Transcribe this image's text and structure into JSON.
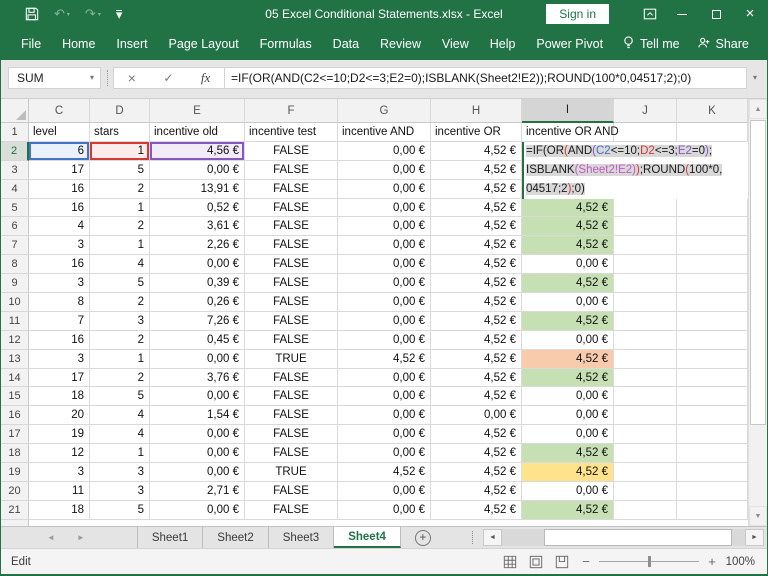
{
  "titlebar": {
    "title": "05 Excel Conditional Statements.xlsx  -  Excel",
    "sign_in_label": "Sign in"
  },
  "menubar": {
    "tabs": [
      "File",
      "Home",
      "Insert",
      "Page Layout",
      "Formulas",
      "Data",
      "Review",
      "View",
      "Help",
      "Power Pivot"
    ],
    "tell_me_label": "Tell me",
    "share_label": "Share"
  },
  "formula_bar": {
    "name_box_value": "SUM",
    "formula": "=IF(OR(AND(C2<=10;D2<=3;E2=0);ISBLANK(Sheet2!E2));ROUND(100*0,04517;2);0)"
  },
  "grid": {
    "column_letters": [
      "C",
      "D",
      "E",
      "F",
      "G",
      "H",
      "I",
      "J",
      "K"
    ],
    "selected_column": "I",
    "active_cell": "I2",
    "header_row": {
      "level": "level",
      "stars": "stars",
      "old": "incentive old",
      "test": "incentive test",
      "and": "incentive AND",
      "or": "incentive OR",
      "oa": "incentive OR AND"
    },
    "rows": [
      {
        "n": "2",
        "level": "6",
        "stars": "1",
        "old": "4,56 €",
        "test": "FALSE",
        "and": "0,00 €",
        "or": "4,52 €",
        "oa": "",
        "fill": "none"
      },
      {
        "n": "3",
        "level": "17",
        "stars": "5",
        "old": "0,00 €",
        "test": "FALSE",
        "and": "0,00 €",
        "or": "4,52 €",
        "oa": "",
        "fill": "none"
      },
      {
        "n": "4",
        "level": "16",
        "stars": "2",
        "old": "13,91 €",
        "test": "FALSE",
        "and": "0,00 €",
        "or": "4,52 €",
        "oa": "",
        "fill": "none"
      },
      {
        "n": "5",
        "level": "16",
        "stars": "1",
        "old": "0,52 €",
        "test": "FALSE",
        "and": "0,00 €",
        "or": "4,52 €",
        "oa": "4,52 €",
        "fill": "green"
      },
      {
        "n": "6",
        "level": "4",
        "stars": "2",
        "old": "3,61 €",
        "test": "FALSE",
        "and": "0,00 €",
        "or": "4,52 €",
        "oa": "4,52 €",
        "fill": "green"
      },
      {
        "n": "7",
        "level": "3",
        "stars": "1",
        "old": "2,26 €",
        "test": "FALSE",
        "and": "0,00 €",
        "or": "4,52 €",
        "oa": "4,52 €",
        "fill": "green"
      },
      {
        "n": "8",
        "level": "16",
        "stars": "4",
        "old": "0,00 €",
        "test": "FALSE",
        "and": "0,00 €",
        "or": "4,52 €",
        "oa": "0,00 €",
        "fill": "none"
      },
      {
        "n": "9",
        "level": "3",
        "stars": "5",
        "old": "0,39 €",
        "test": "FALSE",
        "and": "0,00 €",
        "or": "4,52 €",
        "oa": "4,52 €",
        "fill": "green"
      },
      {
        "n": "10",
        "level": "8",
        "stars": "2",
        "old": "0,26 €",
        "test": "FALSE",
        "and": "0,00 €",
        "or": "4,52 €",
        "oa": "0,00 €",
        "fill": "none"
      },
      {
        "n": "11",
        "level": "7",
        "stars": "3",
        "old": "7,26 €",
        "test": "FALSE",
        "and": "0,00 €",
        "or": "4,52 €",
        "oa": "4,52 €",
        "fill": "green"
      },
      {
        "n": "12",
        "level": "16",
        "stars": "2",
        "old": "0,45 €",
        "test": "FALSE",
        "and": "0,00 €",
        "or": "4,52 €",
        "oa": "0,00 €",
        "fill": "none"
      },
      {
        "n": "13",
        "level": "3",
        "stars": "1",
        "old": "0,00 €",
        "test": "TRUE",
        "and": "4,52 €",
        "or": "4,52 €",
        "oa": "4,52 €",
        "fill": "orange"
      },
      {
        "n": "14",
        "level": "17",
        "stars": "2",
        "old": "3,76 €",
        "test": "FALSE",
        "and": "0,00 €",
        "or": "4,52 €",
        "oa": "4,52 €",
        "fill": "green"
      },
      {
        "n": "15",
        "level": "18",
        "stars": "5",
        "old": "0,00 €",
        "test": "FALSE",
        "and": "0,00 €",
        "or": "4,52 €",
        "oa": "0,00 €",
        "fill": "none"
      },
      {
        "n": "16",
        "level": "20",
        "stars": "4",
        "old": "1,54 €",
        "test": "FALSE",
        "and": "0,00 €",
        "or": "0,00 €",
        "oa": "0,00 €",
        "fill": "none"
      },
      {
        "n": "17",
        "level": "19",
        "stars": "4",
        "old": "0,00 €",
        "test": "FALSE",
        "and": "0,00 €",
        "or": "4,52 €",
        "oa": "0,00 €",
        "fill": "none"
      },
      {
        "n": "18",
        "level": "12",
        "stars": "1",
        "old": "0,00 €",
        "test": "FALSE",
        "and": "0,00 €",
        "or": "4,52 €",
        "oa": "4,52 €",
        "fill": "green"
      },
      {
        "n": "19",
        "level": "3",
        "stars": "3",
        "old": "0,00 €",
        "test": "TRUE",
        "and": "4,52 €",
        "or": "4,52 €",
        "oa": "4,52 €",
        "fill": "yellow"
      },
      {
        "n": "20",
        "level": "11",
        "stars": "3",
        "old": "2,71 €",
        "test": "FALSE",
        "and": "0,00 €",
        "or": "4,52 €",
        "oa": "0,00 €",
        "fill": "none"
      },
      {
        "n": "21",
        "level": "18",
        "stars": "5",
        "old": "0,00 €",
        "test": "FALSE",
        "and": "0,00 €",
        "or": "4,52 €",
        "oa": "4,52 €",
        "fill": "green"
      }
    ],
    "cell_edit": {
      "cell": "I2",
      "lines": [
        [
          {
            "t": "=IF(OR",
            "c": "black"
          },
          {
            "t": "(",
            "c": "red"
          },
          {
            "t": "AND",
            "c": "black"
          },
          {
            "t": "(",
            "c": "purple"
          },
          {
            "t": "C2",
            "c": "blue"
          },
          {
            "t": "<=10;",
            "c": "black"
          },
          {
            "t": "D2",
            "c": "red"
          },
          {
            "t": "<=3;",
            "c": "black"
          },
          {
            "t": "E2",
            "c": "purple"
          },
          {
            "t": "=0",
            "c": "black"
          },
          {
            "t": ")",
            "c": "purple"
          },
          {
            "t": ";",
            "c": "black"
          }
        ],
        [
          {
            "t": "ISBLANK",
            "c": "black"
          },
          {
            "t": "(",
            "c": "magenta"
          },
          {
            "t": "Sheet2!E2",
            "c": "magenta"
          },
          {
            "t": ")",
            "c": "magenta"
          },
          {
            "t": ")",
            "c": "red"
          },
          {
            "t": ";ROUND",
            "c": "black"
          },
          {
            "t": "(",
            "c": "red"
          },
          {
            "t": "100*0,",
            "c": "black"
          }
        ],
        [
          {
            "t": "04517;2",
            "c": "black"
          },
          {
            "t": ")",
            "c": "red"
          },
          {
            "t": ";0)",
            "c": "black"
          }
        ]
      ]
    }
  },
  "sheet_tabs": {
    "labels": [
      "Sheet1",
      "Sheet2",
      "Sheet3",
      "Sheet4"
    ],
    "active": "Sheet4"
  },
  "status_bar": {
    "mode": "Edit",
    "zoom_level": "100%"
  },
  "icons": {
    "undo": "↶",
    "redo": "↷",
    "qat_menu": "▾",
    "name_box_arrow": "▾",
    "cancel": "×",
    "check": "✓",
    "fx": "fx",
    "formula_expand": "▾",
    "close": "×",
    "scroll_up": "▲",
    "scroll_down": "▼",
    "tabs_nav_left": "◄",
    "tabs_nav_right": "►",
    "hscroll_left": "◄",
    "hscroll_right": "►",
    "new_sheet": "+",
    "zoom_out": "−",
    "zoom_in": "+"
  },
  "colors": {
    "excel_green": "#217346",
    "fill_green": "#C6E0B4",
    "fill_orange": "#F8CBAD",
    "fill_yellow": "#FFE28C",
    "ref_blue": "#4472C4",
    "ref_red": "#D13B34",
    "ref_purple": "#8657C1",
    "ref_magenta": "#C05BC0"
  }
}
